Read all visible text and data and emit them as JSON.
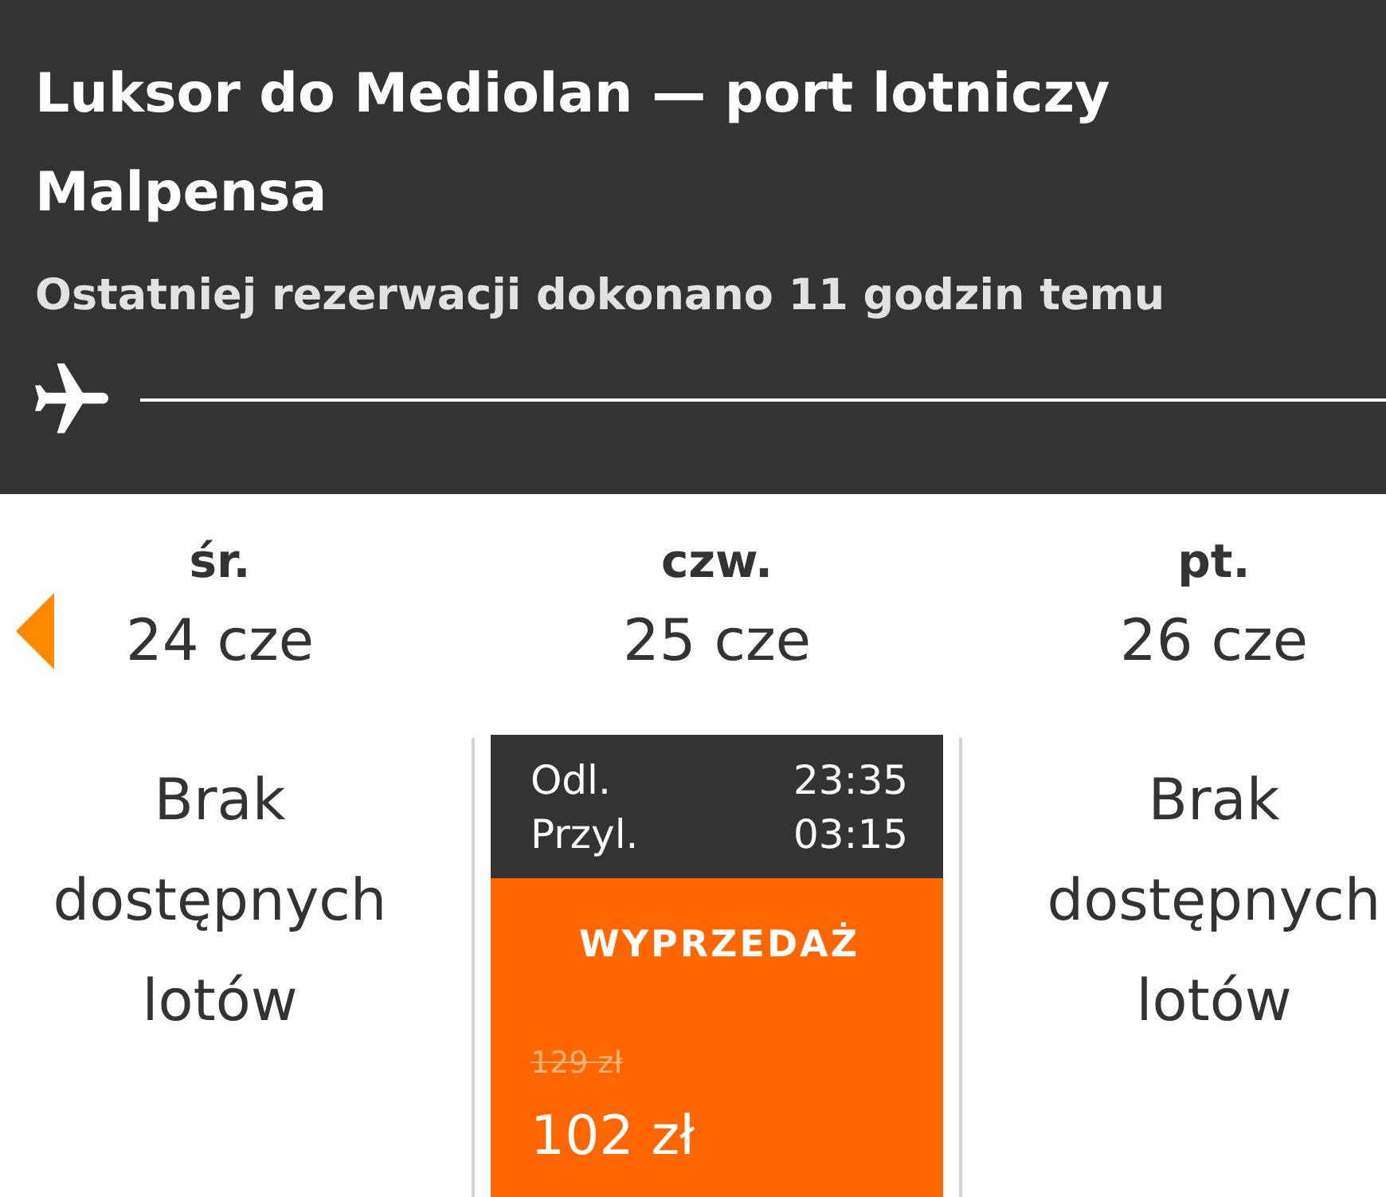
{
  "header": {
    "title": "Luksor do Mediolan — port lotniczy Malpensa",
    "subtitle": "Ostatniej rezerwacji dokonano 11 godzin temu"
  },
  "days": [
    {
      "kind": "unavailable",
      "weekday": "śr.",
      "date": "24 cze",
      "message": "Brak dostępnych lotów"
    },
    {
      "kind": "flight",
      "weekday": "czw.",
      "date": "25 cze",
      "departure_label": "Odl.",
      "departure_time": "23:35",
      "arrival_label": "Przyl.",
      "arrival_time": "03:15",
      "badge": "WYPRZEDAŻ",
      "old_price": "129 zł",
      "price": "102 zł"
    },
    {
      "kind": "unavailable",
      "weekday": "pt.",
      "date": "26 cze",
      "message": "Brak dostępnych lotów"
    }
  ]
}
